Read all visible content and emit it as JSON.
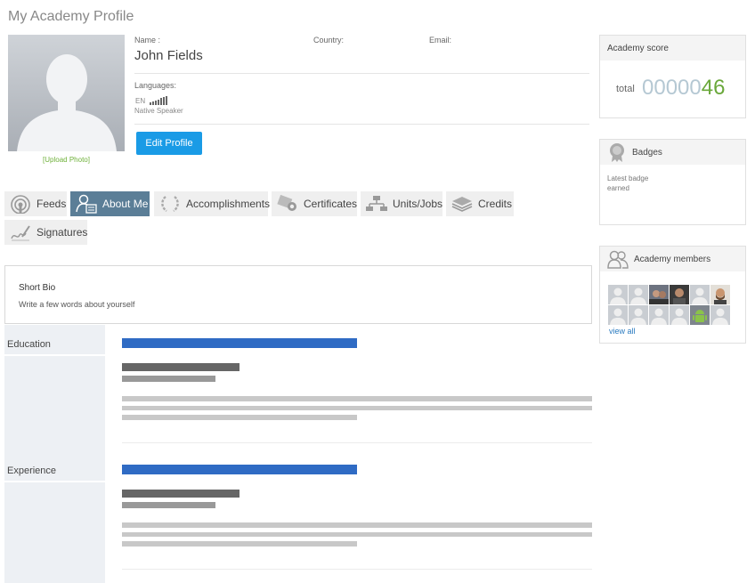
{
  "page": {
    "title": "My Academy Profile"
  },
  "profile": {
    "upload_photo": "[Upload Photo]",
    "name_label": "Name :",
    "name": "John Fields",
    "country_label": "Country:",
    "email_label": "Email:",
    "languages_label": "Languages:",
    "language_code": "EN",
    "language_level": "Native Speaker",
    "edit_button": "Edit Profile"
  },
  "tabs": [
    {
      "label": "Feeds",
      "icon": "feeds-icon"
    },
    {
      "label": "About Me",
      "icon": "about-me-icon",
      "active": true
    },
    {
      "label": "Accomplishments",
      "icon": "laurel-icon"
    },
    {
      "label": "Certificates",
      "icon": "certificate-icon"
    },
    {
      "label": "Units/Jobs",
      "icon": "org-chart-icon"
    },
    {
      "label": "Credits",
      "icon": "stack-icon"
    },
    {
      "label": "Signatures",
      "icon": "signature-icon"
    }
  ],
  "bio": {
    "title": "Short Bio",
    "placeholder": "Write a few words about yourself"
  },
  "sections": {
    "education": "Education",
    "experience": "Experience"
  },
  "sidebar": {
    "score": {
      "title": "Academy score",
      "total_label": "total",
      "leading_zeros": "00000",
      "value": "46"
    },
    "badges": {
      "title": "Badges",
      "latest": "Latest badge earned"
    },
    "members": {
      "title": "Academy members",
      "view_all": "view all"
    }
  },
  "colors": {
    "accent": "#1a9be6",
    "active_tab": "#5b7e97",
    "score_green": "#6aa83b",
    "bar_blue": "#2f6bc4"
  }
}
